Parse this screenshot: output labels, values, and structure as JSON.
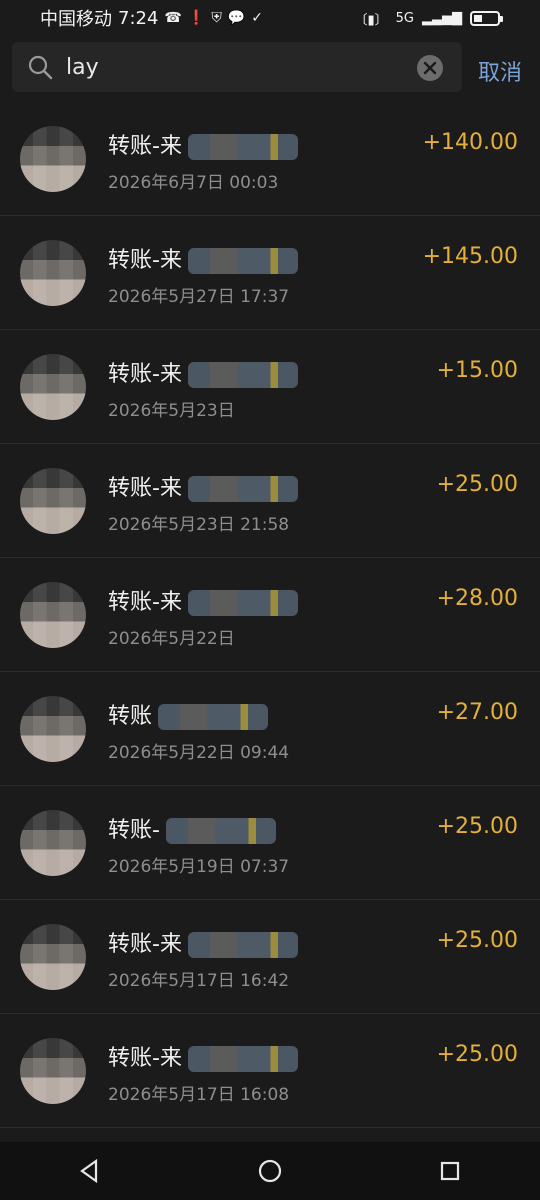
{
  "status": {
    "carrier": "中国移动",
    "time": "7:24",
    "network": "5G",
    "battery_level": 0.35,
    "icons": [
      "missed-call-icon",
      "alert-icon",
      "vpn-icon",
      "chat-icon",
      "shield-icon",
      "vibrate-icon",
      "signal-icon",
      "battery-icon"
    ]
  },
  "search": {
    "query": "lay",
    "cancel_label": "取消"
  },
  "transactions": [
    {
      "title": "转账-来",
      "date": "2026年6月7日 00:03",
      "amount": "+140.00"
    },
    {
      "title": "转账-来",
      "date": "2026年5月27日 17:37",
      "amount": "+145.00"
    },
    {
      "title": "转账-来",
      "date": "2026年5月23日",
      "amount": "+15.00"
    },
    {
      "title": "转账-来",
      "date": "2026年5月23日 21:58",
      "amount": "+25.00"
    },
    {
      "title": "转账-来",
      "date": "2026年5月22日",
      "amount": "+28.00"
    },
    {
      "title": "转账",
      "date": "2026年5月22日 09:44",
      "amount": "+27.00"
    },
    {
      "title": "转账-",
      "date": "2026年5月19日 07:37",
      "amount": "+25.00"
    },
    {
      "title": "转账-来",
      "date": "2026年5月17日 16:42",
      "amount": "+25.00"
    },
    {
      "title": "转账-来",
      "date": "2026年5月17日 16:08",
      "amount": "+25.00"
    }
  ],
  "nav": {
    "icons": [
      "back-icon",
      "home-icon",
      "recent-apps-icon"
    ]
  },
  "colors": {
    "background": "#1b1b1b",
    "amount": "#e4b03a",
    "cancel": "#7aa2d6"
  }
}
